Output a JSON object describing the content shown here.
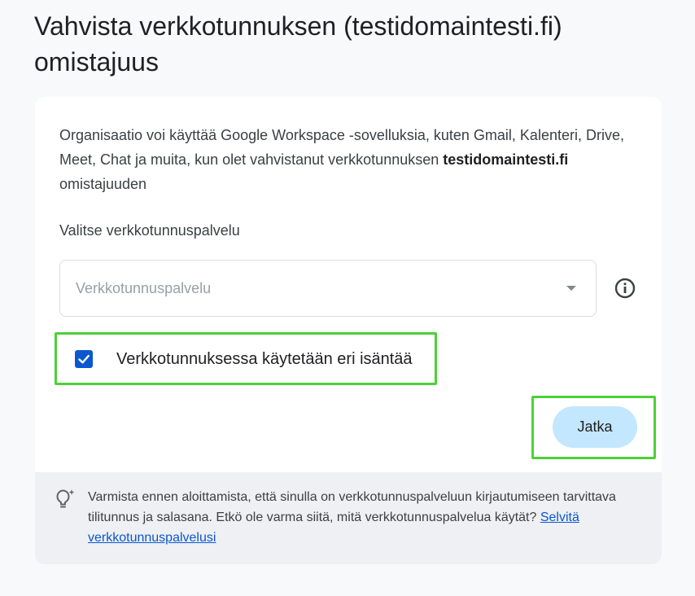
{
  "page": {
    "title": "Vahvista verkkotunnuksen (testidomaintesti.fi) omistajuus"
  },
  "intro": {
    "text_before": "Organisaatio voi käyttää Google Workspace -sovelluksia, kuten Gmail, Kalenteri, Drive, Meet, Chat ja muita, kun olet vahvistanut verkkotunnuksen ",
    "domain": "testidomaintesti.fi",
    "text_after": " omistajuuden"
  },
  "provider": {
    "label": "Valitse verkkotunnuspalvelu",
    "placeholder": "Verkkotunnuspalvelu",
    "selected": ""
  },
  "checkbox": {
    "label": "Verkkotunnuksessa käytetään eri isäntää",
    "checked": true
  },
  "actions": {
    "continue_label": "Jatka"
  },
  "tip": {
    "text": "Varmista ennen aloittamista, että sinulla on verkkotunnuspalveluun kirjautumiseen tarvittava tilitunnus ja salasana. Etkö ole varma siitä, mitä verkkotunnuspalvelua käytät? ",
    "link_label": "Selvitä verkkotunnuspalvelusi"
  },
  "colors": {
    "accent_blue": "#0b57d0",
    "button_bg": "#c2e7ff",
    "highlight_green": "#4cd137",
    "tip_bg": "#eef0f3"
  },
  "icons": {
    "info": "info-icon",
    "tip": "lightbulb-icon",
    "dropdown": "chevron-down-icon",
    "check": "check-icon"
  }
}
